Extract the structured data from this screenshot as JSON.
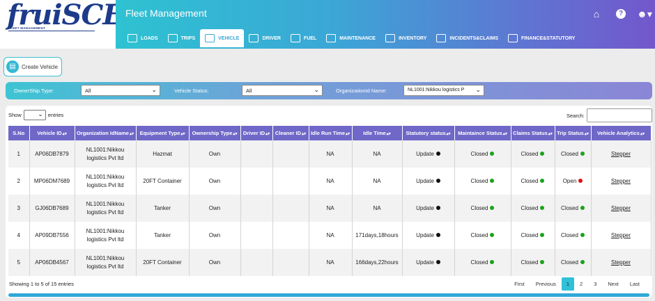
{
  "app": {
    "logo_text": "fruiSCE",
    "logo_tagline": "FLEET MANAGEMENT",
    "title": "Fleet Management"
  },
  "tabs": [
    {
      "label": "LOADS",
      "icon": "truck-load-icon"
    },
    {
      "label": "TRIPS",
      "icon": "trips-icon"
    },
    {
      "label": "VEHICLE",
      "icon": "vehicle-icon"
    },
    {
      "label": "DRIVER",
      "icon": "driver-icon"
    },
    {
      "label": "FUEL",
      "icon": "fuel-icon"
    },
    {
      "label": "MAINTENANCE",
      "icon": "maintenance-icon"
    },
    {
      "label": "INVENTORY",
      "icon": "inventory-icon"
    },
    {
      "label": "INCIDENTS&CLAIMS",
      "icon": "incidents-icon"
    },
    {
      "label": "FINANCE&STATUTORY",
      "icon": "finance-icon"
    }
  ],
  "active_tab": "VEHICLE",
  "header_icons": [
    "home-icon",
    "help-icon",
    "user-icon"
  ],
  "create_button": {
    "label": "Create Vehicle"
  },
  "filters": {
    "ownership_label": "OwnerShip Type:",
    "ownership_value": "All",
    "status_label": "Vehicle Status:",
    "status_value": "All",
    "org_label": "OrganizationId Name:",
    "org_value": "NL1001:Nikkou logistics P"
  },
  "table_controls": {
    "show_label": "Show",
    "entries_label": "entries",
    "search_label": "Search:"
  },
  "columns": [
    "S.No",
    "Vehicle ID",
    "Organization IdName",
    "Equipment Type",
    "Ownership Type",
    "Driver ID",
    "Cleaner ID",
    "Idle Run Time",
    "Idle Time",
    "Statutory status",
    "Maintaince Status",
    "Claims Status",
    "Trip Status",
    "Vehicle Analytics"
  ],
  "rows": [
    {
      "sno": "1",
      "vehicle": "AP06DB7879",
      "org1": "NL1001:Nikkou",
      "org2": "logistics Pvt ltd",
      "equip": "Hazmat",
      "own": "Own",
      "driver": "",
      "cleaner": "",
      "idle_run": "NA",
      "idle": "NA",
      "statutory": "Update",
      "maint": "Closed",
      "claims": "Closed",
      "trip": "Closed",
      "trip_color": "#1aa31a",
      "analytics": "Stepper"
    },
    {
      "sno": "2",
      "vehicle": "MP06DM7689",
      "org1": "NL1001:Nikkou",
      "org2": "logistics Pvt ltd",
      "equip": "20FT Container",
      "own": "Own",
      "driver": "",
      "cleaner": "",
      "idle_run": "NA",
      "idle": "NA",
      "statutory": "Update",
      "maint": "Closed",
      "claims": "Closed",
      "trip": "Open",
      "trip_color": "#e01010",
      "analytics": "Stepper"
    },
    {
      "sno": "3",
      "vehicle": "GJ06DB7689",
      "org1": "NL1001:Nikkou",
      "org2": "logistics Pvt ltd",
      "equip": "Tanker",
      "own": "Own",
      "driver": "",
      "cleaner": "",
      "idle_run": "NA",
      "idle": "NA",
      "statutory": "Update",
      "maint": "Closed",
      "claims": "Closed",
      "trip": "Closed",
      "trip_color": "#1aa31a",
      "analytics": "Stepper"
    },
    {
      "sno": "4",
      "vehicle": "AP09DB7556",
      "org1": "NL1001:Nikkou",
      "org2": "logistics Pvt ltd",
      "equip": "Tanker",
      "own": "Own",
      "driver": "",
      "cleaner": "",
      "idle_run": "NA",
      "idle": "171days,18hours",
      "statutory": "Update",
      "maint": "Closed",
      "claims": "Closed",
      "trip": "Closed",
      "trip_color": "#1aa31a",
      "analytics": "Stepper"
    },
    {
      "sno": "5",
      "vehicle": "AP06DB4567",
      "org1": "NL1001:Nikkou",
      "org2": "logistics Pvt ltd",
      "equip": "20FT Container",
      "own": "Own",
      "driver": "",
      "cleaner": "",
      "idle_run": "NA",
      "idle": "166days,22hours",
      "statutory": "Update",
      "maint": "Closed",
      "claims": "Closed",
      "trip": "Closed",
      "trip_color": "#1aa31a",
      "analytics": "Stepper"
    }
  ],
  "colors": {
    "statutory_dot": "#111111",
    "status_green": "#1aa31a",
    "status_red": "#e01010",
    "header_purple": "#6f68c8",
    "accent_cyan": "#30c0d8"
  },
  "footer": {
    "info": "Showing 1 to 5 of 15 entries",
    "pages": [
      "First",
      "Previous",
      "1",
      "2",
      "3",
      "Next",
      "Last"
    ],
    "current_page": "1"
  }
}
